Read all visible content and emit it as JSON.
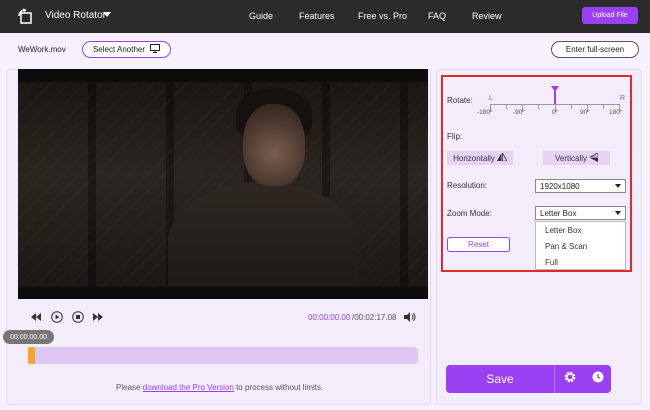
{
  "header": {
    "app_title": "Video Rotator",
    "nav": [
      "Guide",
      "Features",
      "Free vs. Pro",
      "FAQ",
      "Review"
    ],
    "upload_label": "Upload File"
  },
  "file": {
    "name": "WeWork.mov",
    "select_another_label": "Select Another",
    "fullscreen_label": "Enter full-screen"
  },
  "player": {
    "current_time": "00:00:00.00",
    "total_time": "/00:02:17.08",
    "timestamp_badge": "00:00:00.00",
    "progress": 0
  },
  "pro_note": {
    "prefix": "Please ",
    "link": "download the Pro Version",
    "suffix": " to process without limits."
  },
  "settings": {
    "rotate_label": "Rotate:",
    "rotate_left": "L",
    "rotate_right": "R",
    "rotate_ticks": [
      "-180°",
      "-90°",
      "0°",
      "90°",
      "180°"
    ],
    "rotate_value": 0,
    "flip_label": "Flip:",
    "flip_horizontal": "Horizontally",
    "flip_vertical": "Vertically",
    "resolution_label": "Resolution:",
    "resolution_value": "1920x1080",
    "zoom_label": "Zoom Mode:",
    "zoom_value": "Letter Box",
    "zoom_options": [
      "Letter Box",
      "Pan & Scan",
      "Full"
    ],
    "reset_label": "Reset"
  },
  "save_label": "Save",
  "colors": {
    "accent": "#9a3ff2",
    "highlight_border": "#e02b2b",
    "timeline_handle": "#f5a623"
  }
}
